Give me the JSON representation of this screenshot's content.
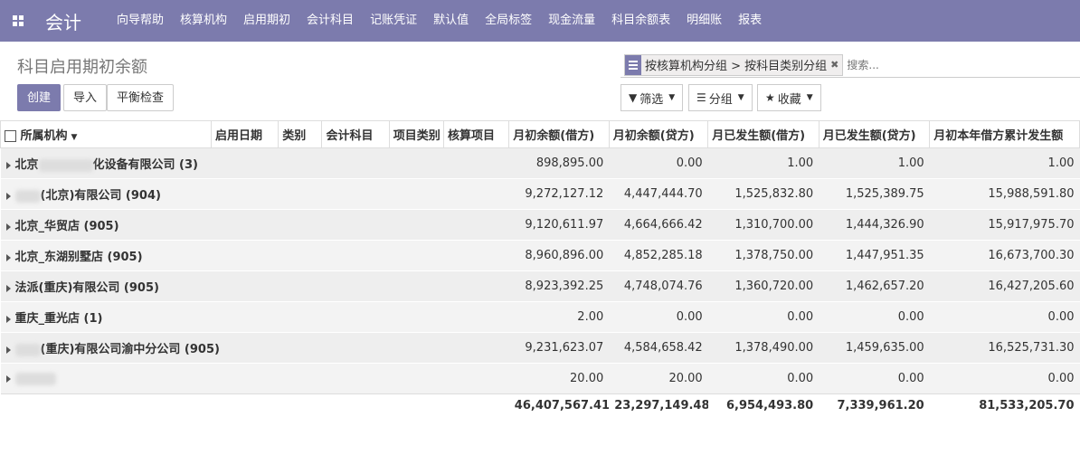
{
  "topbar": {
    "app_title": "会计",
    "menu": [
      "向导帮助",
      "核算机构",
      "启用期初",
      "会计科目",
      "记账凭证",
      "默认值",
      "全局标签",
      "现金流量",
      "科目余额表",
      "明细账",
      "报表"
    ]
  },
  "control": {
    "page_title": "科目启用期初余额",
    "create_label": "创建",
    "import_label": "导入",
    "balance_check_label": "平衡检查",
    "search_facet": "按核算机构分组 > 按科目类别分组",
    "search_placeholder": "搜索...",
    "filter_label": "筛选",
    "group_label": "分组",
    "favorite_label": "收藏"
  },
  "table": {
    "headers": [
      "所属机构",
      "启用日期",
      "类别",
      "会计科目",
      "项目类别",
      "核算项目",
      "月初余额(借方)",
      "月初余额(贷方)",
      "月已发生额(借方)",
      "月已发生额(贷方)",
      "月初本年借方累计发生额"
    ],
    "groups": [
      {
        "prefix": "北京",
        "suffix": "化设备有限公司 (3)",
        "v1": "898,895.00",
        "v2": "0.00",
        "v3": "1.00",
        "v4": "1.00",
        "v5": "1.00"
      },
      {
        "prefix": "",
        "suffix": "(北京)有限公司 (904)",
        "v1": "9,272,127.12",
        "v2": "4,447,444.70",
        "v3": "1,525,832.80",
        "v4": "1,525,389.75",
        "v5": "15,988,591.80"
      },
      {
        "prefix": "",
        "suffix": "北京_华贸店 (905)",
        "v1": "9,120,611.97",
        "v2": "4,664,666.42",
        "v3": "1,310,700.00",
        "v4": "1,444,326.90",
        "v5": "15,917,975.70"
      },
      {
        "prefix": "",
        "suffix": "北京_东湖别墅店 (905)",
        "v1": "8,960,896.00",
        "v2": "4,852,285.18",
        "v3": "1,378,750.00",
        "v4": "1,447,951.35",
        "v5": "16,673,700.30"
      },
      {
        "prefix": "",
        "suffix": "法派(重庆)有限公司 (905)",
        "v1": "8,923,392.25",
        "v2": "4,748,074.76",
        "v3": "1,360,720.00",
        "v4": "1,462,657.20",
        "v5": "16,427,205.60"
      },
      {
        "prefix": "",
        "suffix": "重庆_重光店 (1)",
        "v1": "2.00",
        "v2": "0.00",
        "v3": "0.00",
        "v4": "0.00",
        "v5": "0.00"
      },
      {
        "prefix": "",
        "suffix": "(重庆)有限公司渝中分公司 (905)",
        "v1": "9,231,623.07",
        "v2": "4,584,658.42",
        "v3": "1,378,490.00",
        "v4": "1,459,635.00",
        "v5": "16,525,731.30"
      },
      {
        "prefix": "",
        "suffix": "",
        "v1": "20.00",
        "v2": "20.00",
        "v3": "0.00",
        "v4": "0.00",
        "v5": "0.00"
      }
    ],
    "totals": {
      "v1": "46,407,567.41",
      "v2": "23,297,149.48",
      "v3": "6,954,493.80",
      "v4": "7,339,961.20",
      "v5": "81,533,205.70"
    }
  }
}
